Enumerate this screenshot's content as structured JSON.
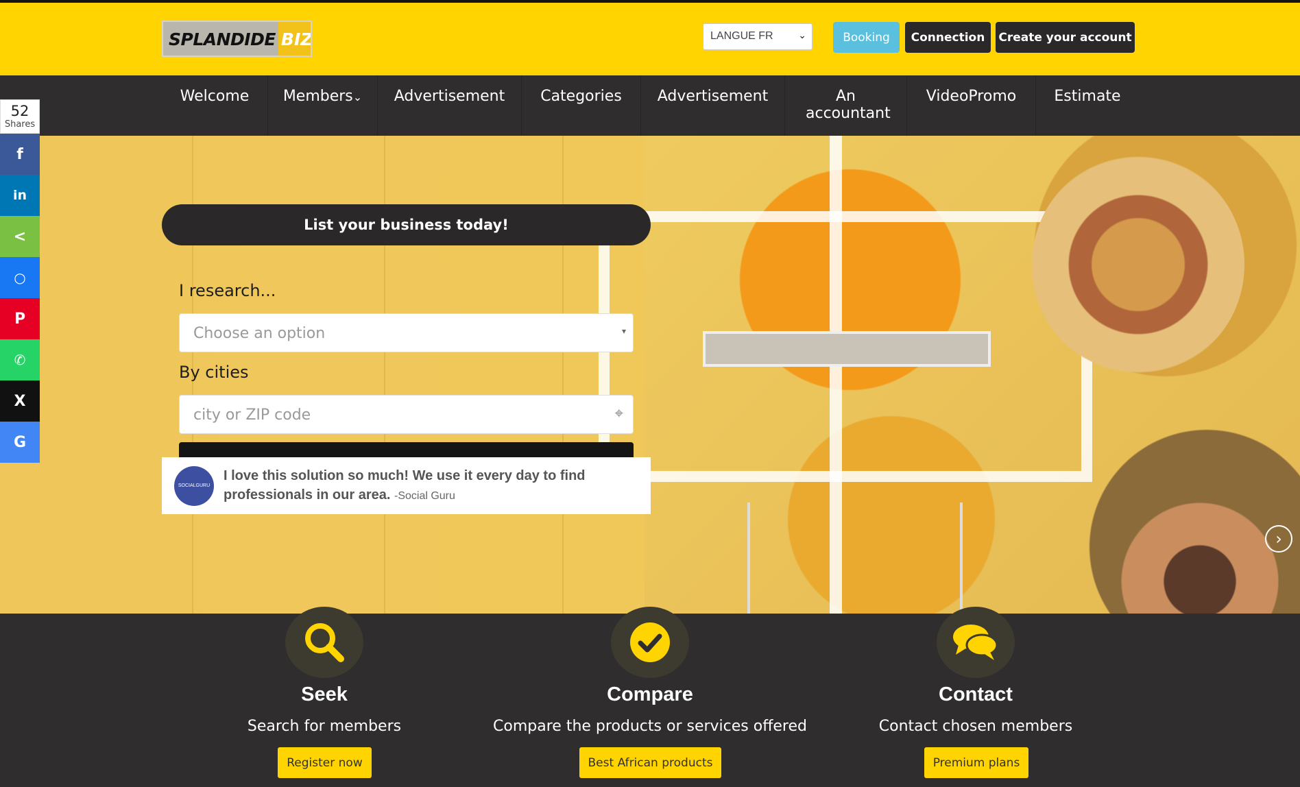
{
  "header": {
    "logo_left": "SPLANDIDE",
    "logo_right": "BIZ",
    "language_select": "LANGUE FR",
    "booking": "Booking",
    "connection": "Connection",
    "create_account": "Create your account"
  },
  "nav": {
    "items": [
      "Welcome",
      "Members",
      "Advertisement",
      "Categories",
      "Advertisement",
      "An accountant",
      "VideoPromo",
      "Estimate"
    ]
  },
  "social": {
    "count": "52",
    "count_label": "Shares",
    "networks": [
      "facebook-icon",
      "linkedin-icon",
      "share-icon",
      "messenger-icon",
      "pinterest-icon",
      "whatsapp-icon",
      "x-icon",
      "google-icon"
    ]
  },
  "hero": {
    "cta": "List your business today!",
    "research_label": "I research...",
    "research_placeholder": "Choose an option",
    "cities_label": "By cities",
    "cities_placeholder": "city or ZIP code",
    "testimonial_quote": "I love this solution so much! We use it every day to find professionals in our area.",
    "testimonial_author": "-Social Guru",
    "avatar_text": "SOCIALGURU"
  },
  "features": [
    {
      "title": "Seek",
      "desc": "Search for members",
      "button": "Register now"
    },
    {
      "title": "Compare",
      "desc": "Compare the products or services offered",
      "button": "Best African products"
    },
    {
      "title": "Contact",
      "desc": "Contact chosen members",
      "button": "Premium plans"
    }
  ],
  "colors": {
    "brand_yellow": "#ffd400",
    "dark": "#2f2d2d",
    "booking": "#5bc0de"
  }
}
